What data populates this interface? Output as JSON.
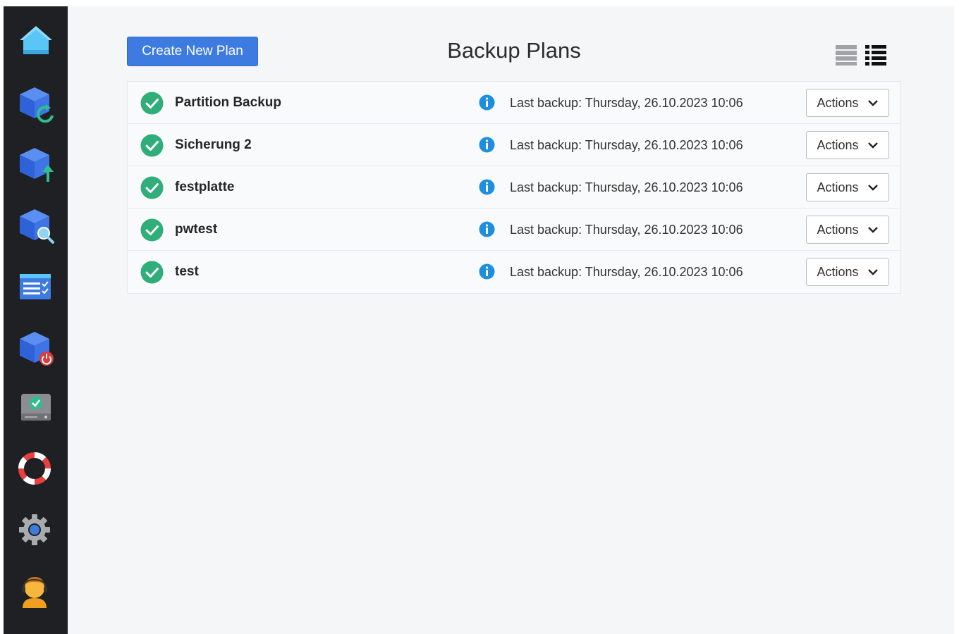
{
  "sidebar": {
    "items": [
      {
        "id": "home",
        "icon": "home-icon"
      },
      {
        "id": "restore",
        "icon": "cube-refresh-icon"
      },
      {
        "id": "upload",
        "icon": "cube-upload-icon"
      },
      {
        "id": "search",
        "icon": "cube-search-icon"
      },
      {
        "id": "tasks",
        "icon": "checklist-icon"
      },
      {
        "id": "shutdown",
        "icon": "cube-power-icon"
      },
      {
        "id": "drive",
        "icon": "drive-check-icon"
      },
      {
        "id": "support",
        "icon": "lifebuoy-icon"
      },
      {
        "id": "settings",
        "icon": "gear-icon"
      },
      {
        "id": "account",
        "icon": "user-avatar-icon"
      }
    ]
  },
  "toolbar": {
    "create_label": "Create New Plan",
    "title": "Backup Plans"
  },
  "plans": [
    {
      "name": "Partition Backup",
      "status": "ok",
      "last_backup": "Last backup: Thursday, 26.10.2023 10:06",
      "action_label": "Actions"
    },
    {
      "name": "Sicherung 2",
      "status": "ok",
      "last_backup": "Last backup: Thursday, 26.10.2023 10:06",
      "action_label": "Actions"
    },
    {
      "name": "festplatte",
      "status": "ok",
      "last_backup": "Last backup: Thursday, 26.10.2023 10:06",
      "action_label": "Actions"
    },
    {
      "name": "pwtest",
      "status": "ok",
      "last_backup": "Last backup: Thursday, 26.10.2023 10:06",
      "action_label": "Actions"
    },
    {
      "name": "test",
      "status": "ok",
      "last_backup": "Last backup: Thursday, 26.10.2023 10:06",
      "action_label": "Actions"
    }
  ],
  "colors": {
    "sidebar_bg": "#1f2023",
    "main_bg": "#f5f6f8",
    "primary": "#3d7be0",
    "success": "#2fae7a",
    "info": "#1e8fe0"
  }
}
